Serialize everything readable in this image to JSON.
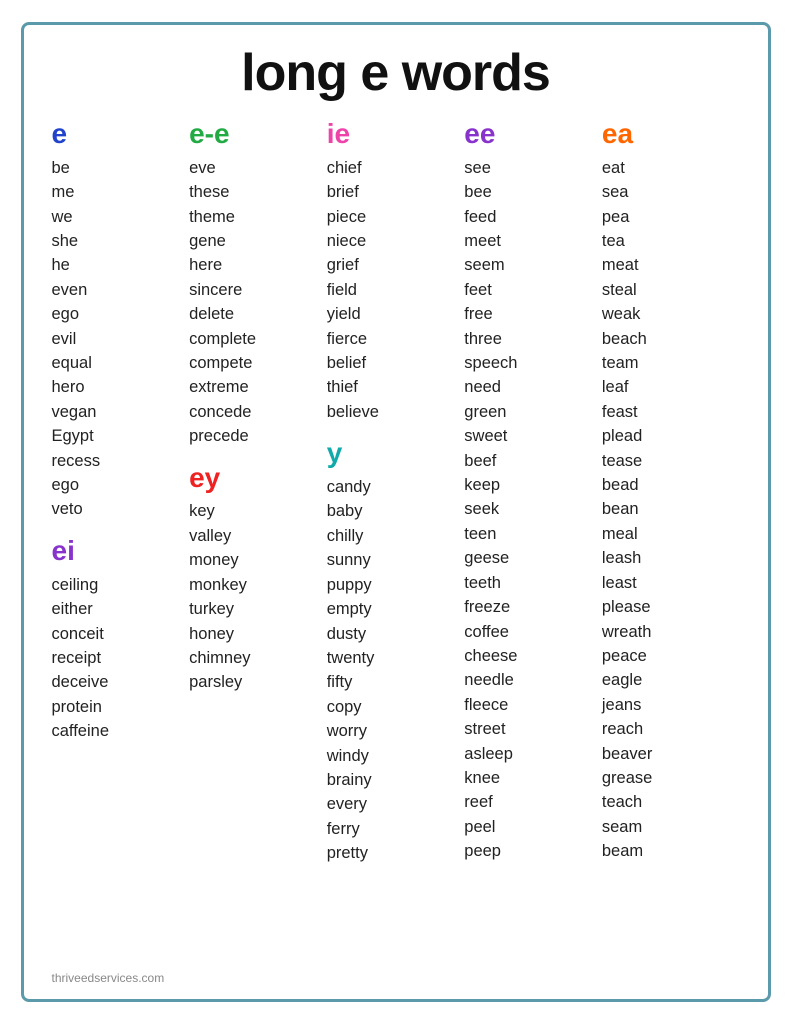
{
  "title": "long e words",
  "footer": "thriveedservices.com",
  "columns": [
    {
      "id": "col-e",
      "sections": [
        {
          "header": "e",
          "headerClass": "blue",
          "words": [
            "be",
            "me",
            "we",
            "she",
            "he",
            "even",
            "ego",
            "evil",
            "equal",
            "hero",
            "vegan",
            "Egypt",
            "recess",
            "ego",
            "veto"
          ]
        },
        {
          "header": "ei",
          "headerClass": "purple",
          "words": [
            "ceiling",
            "either",
            "conceit",
            "receipt",
            "deceive",
            "protein",
            "caffeine"
          ]
        }
      ]
    },
    {
      "id": "col-ee",
      "sections": [
        {
          "header": "e-e",
          "headerClass": "green",
          "words": [
            "eve",
            "these",
            "theme",
            "gene",
            "here",
            "sincere",
            "delete",
            "complete",
            "compete",
            "extreme",
            "concede",
            "precede"
          ]
        },
        {
          "header": "ey",
          "headerClass": "red",
          "words": [
            "key",
            "valley",
            "money",
            "monkey",
            "turkey",
            "honey",
            "chimney",
            "parsley"
          ]
        }
      ]
    },
    {
      "id": "col-ie",
      "sections": [
        {
          "header": "ie",
          "headerClass": "pink",
          "words": [
            "chief",
            "brief",
            "piece",
            "niece",
            "grief",
            "field",
            "yield",
            "fierce",
            "belief",
            "thief",
            "believe"
          ]
        },
        {
          "header": "y",
          "headerClass": "teal",
          "words": [
            "candy",
            "baby",
            "chilly",
            "sunny",
            "puppy",
            "empty",
            "dusty",
            "twenty",
            "fifty",
            "copy",
            "worry",
            "windy",
            "brainy",
            "every",
            "ferry",
            "pretty"
          ]
        }
      ]
    },
    {
      "id": "col-ee2",
      "sections": [
        {
          "header": "ee",
          "headerClass": "purple",
          "words": [
            "see",
            "bee",
            "feed",
            "meet",
            "seem",
            "feet",
            "free",
            "three",
            "speech",
            "need",
            "green",
            "sweet",
            "beef",
            "keep",
            "seek",
            "teen",
            "geese",
            "teeth",
            "freeze",
            "coffee",
            "cheese",
            "needle",
            "fleece",
            "street",
            "asleep",
            "knee",
            "reef",
            "peel",
            "peep"
          ]
        }
      ]
    },
    {
      "id": "col-ea",
      "sections": [
        {
          "header": "ea",
          "headerClass": "orange",
          "words": [
            "eat",
            "sea",
            "pea",
            "tea",
            "meat",
            "steal",
            "weak",
            "beach",
            "team",
            "leaf",
            "feast",
            "plead",
            "tease",
            "bead",
            "bean",
            "meal",
            "leash",
            "least",
            "please",
            "wreath",
            "peace",
            "eagle",
            "jeans",
            "reach",
            "beaver",
            "grease",
            "teach",
            "seam",
            "beam"
          ]
        }
      ]
    }
  ]
}
